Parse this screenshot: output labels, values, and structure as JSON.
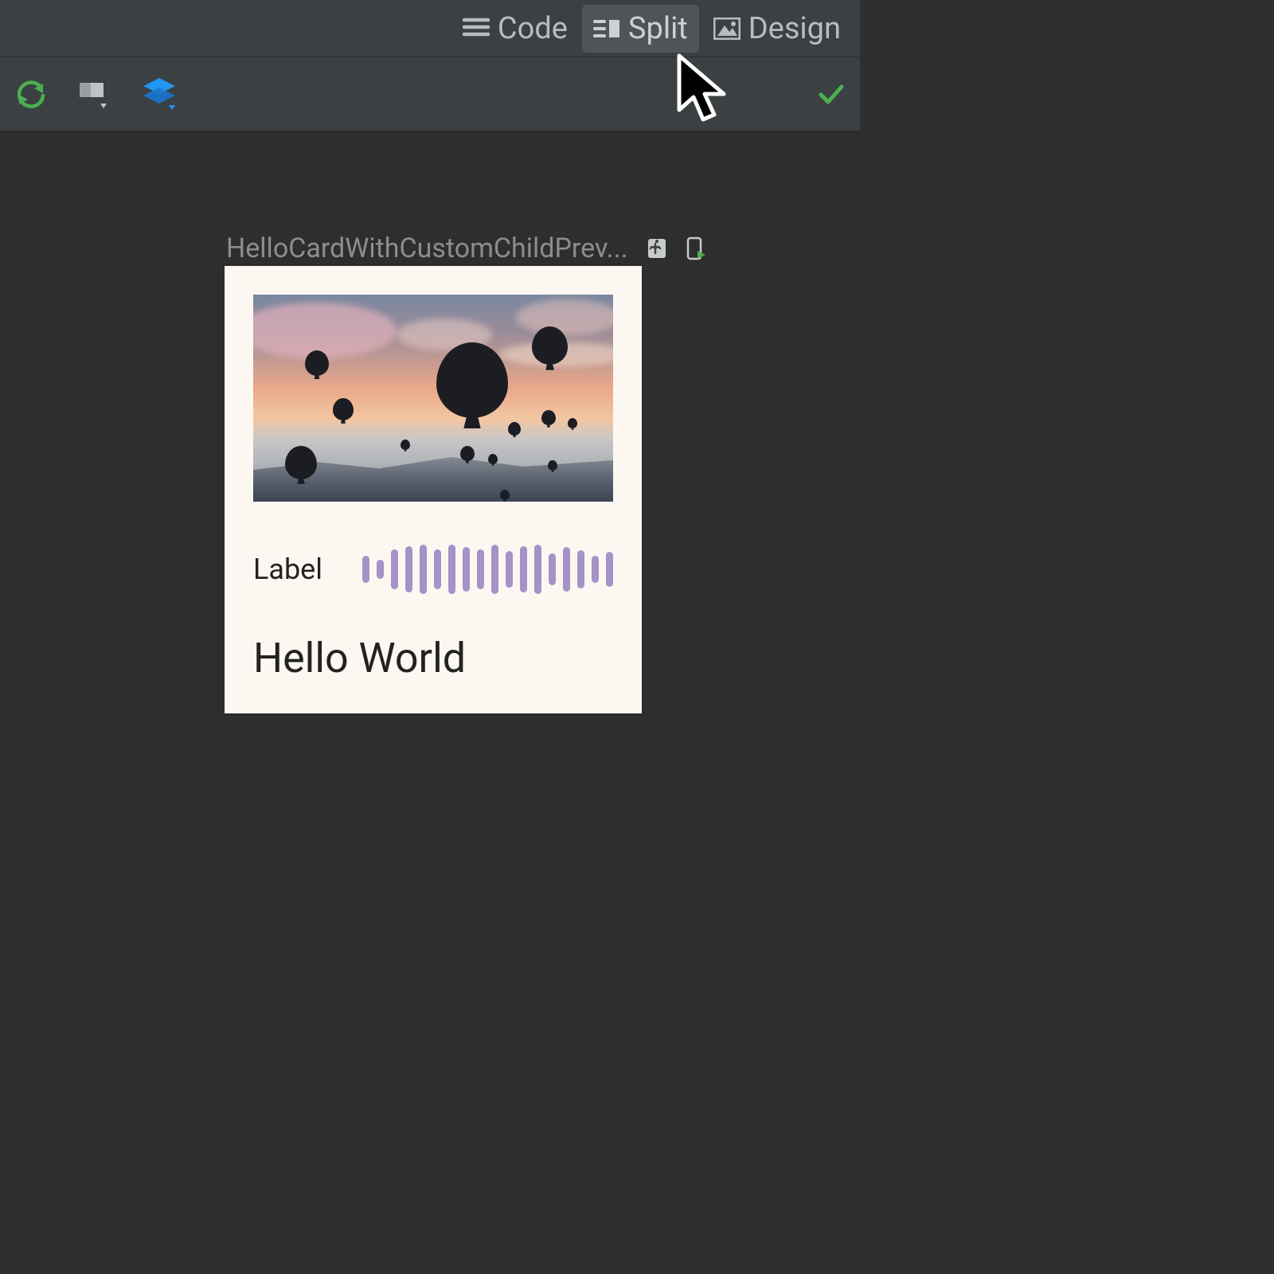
{
  "tabs": {
    "code": "Code",
    "split": "Split",
    "design": "Design",
    "active": "split"
  },
  "preview": {
    "name": "HelloCardWithCustomChildPrev..."
  },
  "card": {
    "label": "Label",
    "title": "Hello World"
  },
  "waveform_heights": [
    34,
    24,
    50,
    58,
    62,
    50,
    62,
    56,
    50,
    62,
    46,
    58,
    62,
    40,
    56,
    48,
    34,
    44
  ]
}
